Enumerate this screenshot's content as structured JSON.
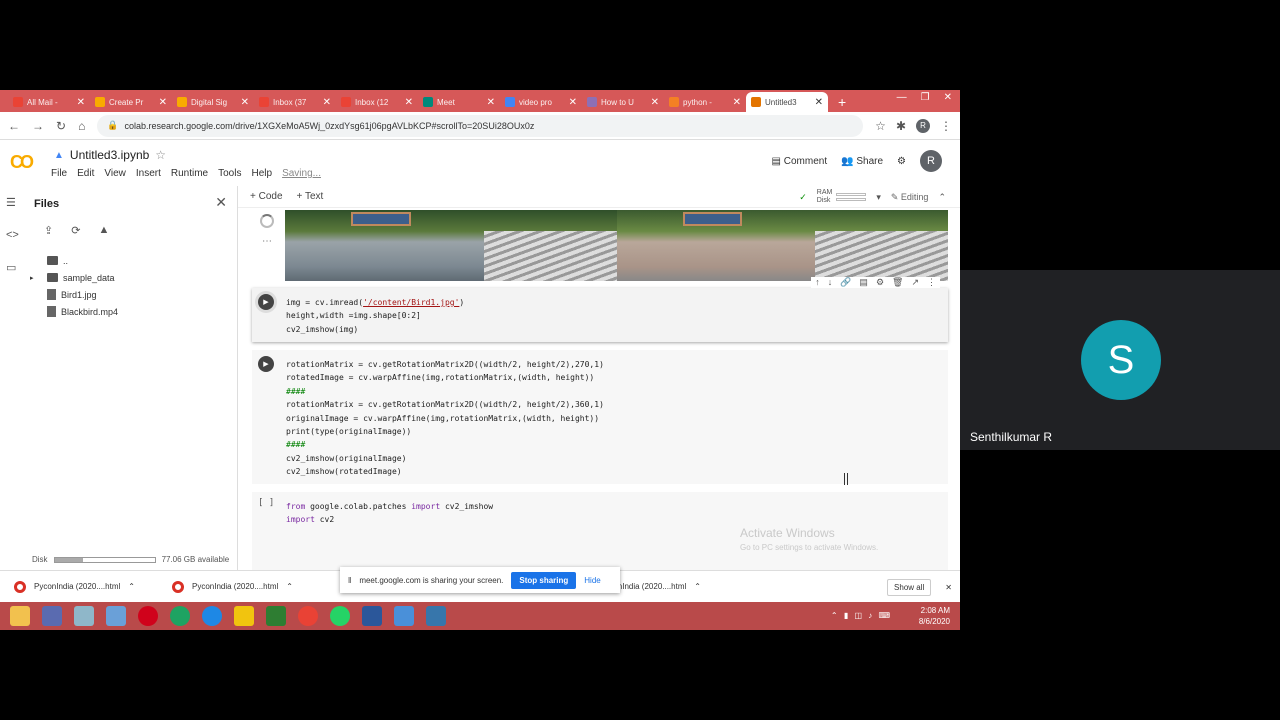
{
  "browser": {
    "tabs": [
      {
        "label": "All Mail -",
        "color": "#ea4335",
        "active": false
      },
      {
        "label": "Create Pr",
        "color": "#f9ab00",
        "active": false
      },
      {
        "label": "Digital Sig",
        "color": "#f9ab00",
        "active": false
      },
      {
        "label": "Inbox (37",
        "color": "#ea4335",
        "active": false
      },
      {
        "label": "Inbox (12",
        "color": "#ea4335",
        "active": false
      },
      {
        "label": "Meet",
        "color": "#00897b",
        "active": false
      },
      {
        "label": "video pro",
        "color": "#4285f4",
        "active": false
      },
      {
        "label": "How to U",
        "color": "#8e6fb5",
        "active": false
      },
      {
        "label": "python -",
        "color": "#f48024",
        "active": false
      },
      {
        "label": "Untitled3",
        "color": "#e37400",
        "active": true
      }
    ],
    "url": "colab.research.google.com/drive/1XGXeMoA5Wj_0zxdYsg61j06pgAVLbKCP#scrollTo=20SUi28OUx0z",
    "profile_initial": "R"
  },
  "colab": {
    "notebook_title": "Untitled3.ipynb",
    "menu": [
      "File",
      "Edit",
      "View",
      "Insert",
      "Runtime",
      "Tools",
      "Help"
    ],
    "status": "Saving...",
    "comment_label": "Comment",
    "share_label": "Share",
    "user_initial": "R",
    "add_code": "+ Code",
    "add_text": "+ Text",
    "ram_label": "RAM",
    "disk_label": "Disk",
    "editing_label": "Editing"
  },
  "sidebar": {
    "title": "Files",
    "tree": [
      {
        "name": "..",
        "type": "folder"
      },
      {
        "name": "sample_data",
        "type": "folder"
      },
      {
        "name": "Bird1.jpg",
        "type": "file"
      },
      {
        "name": "Blackbird.mp4",
        "type": "file"
      }
    ],
    "disk_label": "Disk",
    "disk_available": "77.06 GB available",
    "disk_used_fraction": 0.28
  },
  "cells": {
    "cell2_lines": [
      "img = cv.imread('/content/Bird1.jpg')",
      "height,width =img.shape[0:2]",
      "cv2_imshow(img)"
    ],
    "cell3_lines": [
      "rotationMatrix = cv.getRotationMatrix2D((width/2, height/2),270,1)",
      "rotatedImage = cv.warpAffine(img,rotationMatrix,(width, height))",
      "####",
      "rotationMatrix = cv.getRotationMatrix2D((width/2, height/2),360,1)",
      "originalImage = cv.warpAffine(img,rotationMatrix,(width, height))",
      "print(type(originalImage))",
      "####",
      "cv2_imshow(originalImage)",
      "cv2_imshow(rotatedImage)"
    ],
    "cell4_bracket": "[ ]",
    "cell4_lines": [
      "from google.colab.patches import cv2_imshow",
      "import cv2"
    ]
  },
  "watermark": {
    "title": "Activate Windows",
    "subtitle": "Go to PC settings to activate Windows."
  },
  "share_banner": {
    "text": "meet.google.com is sharing your screen.",
    "stop_label": "Stop sharing",
    "hide_label": "Hide"
  },
  "downloads": {
    "items": [
      "PyconIndia (2020....html",
      "PyconIndia (2020....html",
      "PyconIndia (2020....html"
    ],
    "show_all": "Show all"
  },
  "taskbar": {
    "time": "2:08 AM",
    "date": "8/6/2020"
  },
  "participant": {
    "initial": "S",
    "name": "Senthilkumar R"
  }
}
